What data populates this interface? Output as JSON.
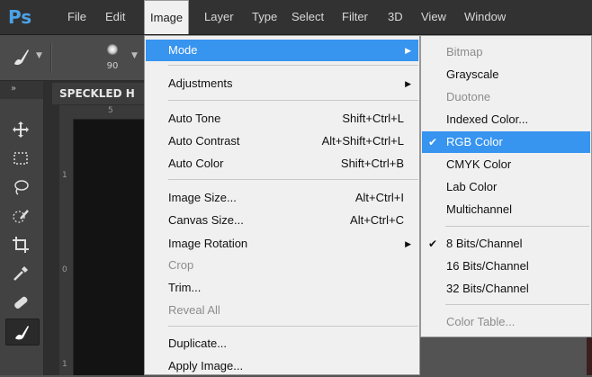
{
  "app": {
    "logo": "Ps",
    "menu": [
      "File",
      "Edit",
      "Image",
      "Layer",
      "Type",
      "Select",
      "Filter",
      "3D",
      "View",
      "Window"
    ],
    "active_menu": "Image"
  },
  "options": {
    "brush_size": "90"
  },
  "document": {
    "tab_title": "SPECKLED H",
    "ruler_top": "5",
    "ruler_left": [
      "1",
      "0",
      "1"
    ]
  },
  "image_menu": {
    "mode": "Mode",
    "adjustments": "Adjustments",
    "auto_tone": "Auto Tone",
    "auto_tone_sc": "Shift+Ctrl+L",
    "auto_contrast": "Auto Contrast",
    "auto_contrast_sc": "Alt+Shift+Ctrl+L",
    "auto_color": "Auto Color",
    "auto_color_sc": "Shift+Ctrl+B",
    "image_size": "Image Size...",
    "image_size_sc": "Alt+Ctrl+I",
    "canvas_size": "Canvas Size...",
    "canvas_size_sc": "Alt+Ctrl+C",
    "image_rotation": "Image Rotation",
    "crop": "Crop",
    "trim": "Trim...",
    "reveal_all": "Reveal All",
    "duplicate": "Duplicate...",
    "apply_image": "Apply Image..."
  },
  "mode_menu": {
    "bitmap": "Bitmap",
    "grayscale": "Grayscale",
    "duotone": "Duotone",
    "indexed": "Indexed Color...",
    "rgb": "RGB Color",
    "cmyk": "CMYK Color",
    "lab": "Lab Color",
    "multichannel": "Multichannel",
    "bits8": "8 Bits/Channel",
    "bits16": "16 Bits/Channel",
    "bits32": "32 Bits/Channel",
    "color_table": "Color Table...",
    "checkmark": "✔"
  },
  "colors": {
    "highlight": "#3794ef",
    "menu_bg": "#f0f0f0",
    "chrome": "#323232",
    "logo": "#4aa3e8"
  }
}
